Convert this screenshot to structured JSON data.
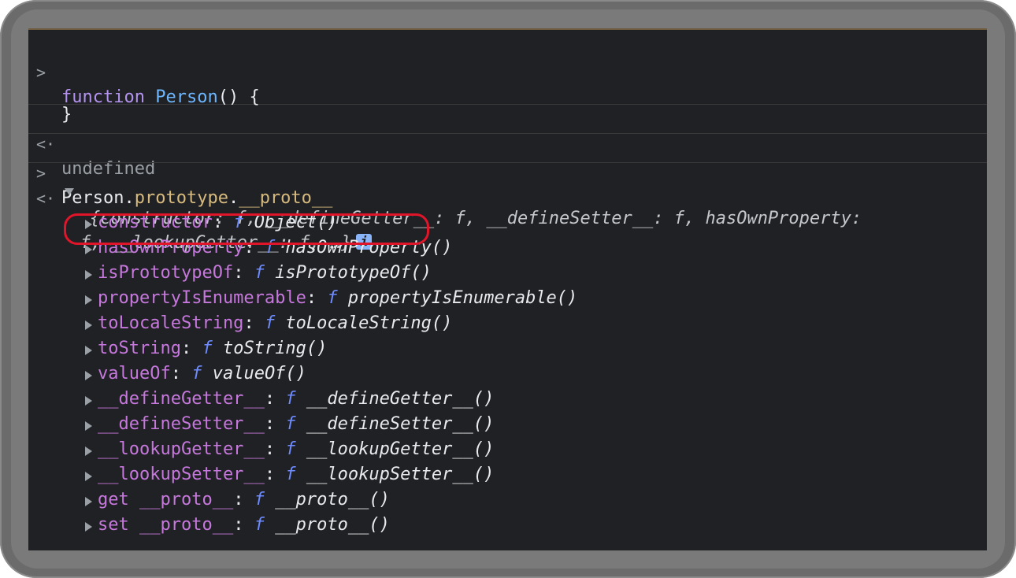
{
  "console": {
    "entry1": {
      "prompt": ">",
      "line1": {
        "keyword": "function",
        "name": "Person",
        "rest": "() {"
      },
      "line2": "",
      "line3": "}"
    },
    "entry2": {
      "prompt": "<·",
      "value": "undefined"
    },
    "entry3": {
      "prompt": ">",
      "obj": "Person",
      "dot1": ".",
      "prop1": "prototype",
      "dot2": ".",
      "prop2": "__proto__"
    },
    "entry4": {
      "prompt": "<·",
      "summary_line1": "{constructor: f, __defineGetter__: f, __defineSetter__: f, hasOwnProperty:",
      "summary_line2": "f, __lookupGetter__: f, …}",
      "info_badge": "i",
      "properties": [
        {
          "key": "constructor",
          "sep": ": ",
          "f": "f",
          "value": " Object()"
        },
        {
          "key": "hasOwnProperty",
          "sep": ": ",
          "f": "f",
          "value": " hasOwnProperty()"
        },
        {
          "key": "isPrototypeOf",
          "sep": ": ",
          "f": "f",
          "value": " isPrototypeOf()"
        },
        {
          "key": "propertyIsEnumerable",
          "sep": ": ",
          "f": "f",
          "value": " propertyIsEnumerable()"
        },
        {
          "key": "toLocaleString",
          "sep": ": ",
          "f": "f",
          "value": " toLocaleString()"
        },
        {
          "key": "toString",
          "sep": ": ",
          "f": "f",
          "value": " toString()"
        },
        {
          "key": "valueOf",
          "sep": ": ",
          "f": "f",
          "value": " valueOf()"
        },
        {
          "key": "__defineGetter__",
          "sep": ": ",
          "f": "f",
          "value": " __defineGetter__()"
        },
        {
          "key": "__defineSetter__",
          "sep": ": ",
          "f": "f",
          "value": " __defineSetter__()"
        },
        {
          "key": "__lookupGetter__",
          "sep": ": ",
          "f": "f",
          "value": " __lookupGetter__()"
        },
        {
          "key": "__lookupSetter__",
          "sep": ": ",
          "f": "f",
          "value": " __lookupSetter__()"
        },
        {
          "key": "get __proto__",
          "sep": ": ",
          "f": "f",
          "value": " __proto__()"
        },
        {
          "key": "set __proto__",
          "sep": ": ",
          "f": "f",
          "value": " __proto__()"
        }
      ]
    }
  },
  "colors": {
    "background": "#202124",
    "highlight_ring": "#e0152a",
    "keyword": "#b392f0",
    "function_name": "#6cb6ff",
    "property_key": "#c678dd",
    "prototype_prop": "#d7ba7d",
    "f_glyph": "#6e8cff"
  },
  "icons": {
    "input_prompt": "chevron-right-icon",
    "output_prompt": "return-arrow-icon",
    "expand": "triangle-right-icon",
    "collapse": "triangle-down-icon",
    "info": "info-icon"
  }
}
